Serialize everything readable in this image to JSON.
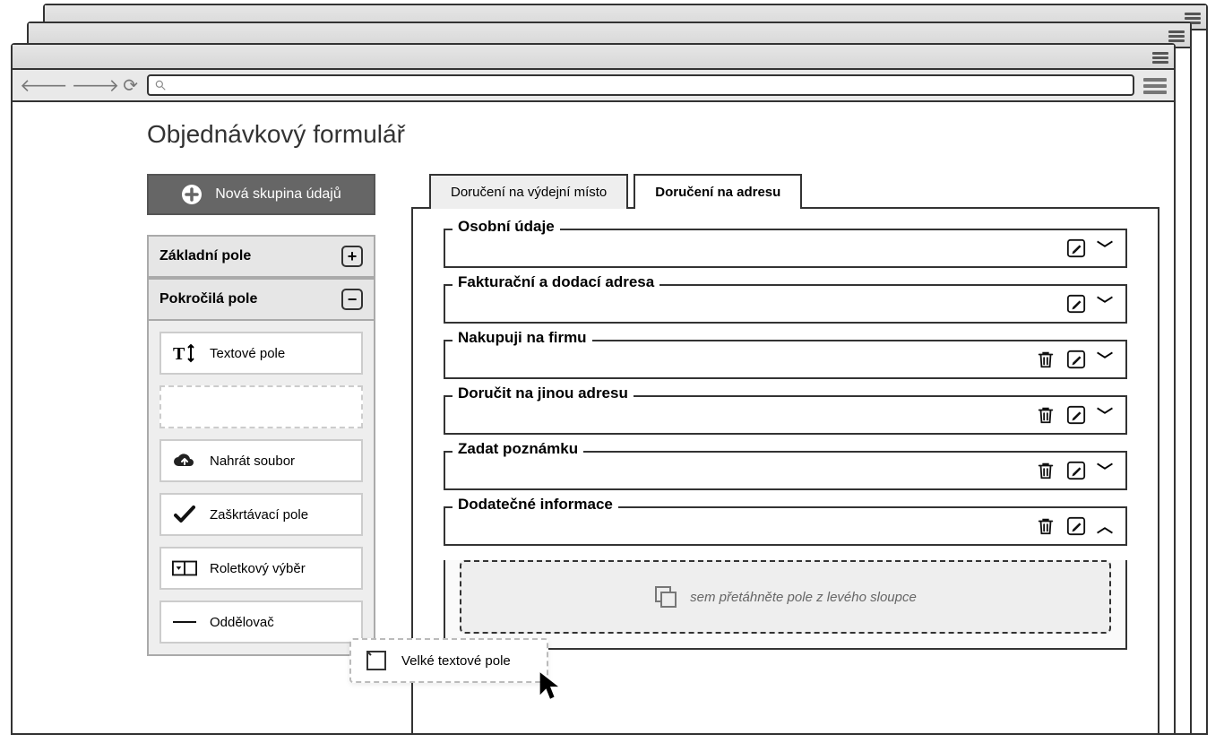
{
  "page_title": "Objednávkový formulář",
  "new_group_button": "Nová skupina údajů",
  "sidebar": {
    "basic_header": "Základní pole",
    "advanced_header": "Pokročilá pole",
    "items": [
      {
        "label": "Textové pole"
      },
      {
        "label": ""
      },
      {
        "label": "Nahrát soubor"
      },
      {
        "label": "Zaškrtávací pole"
      },
      {
        "label": "Roletkový výběr"
      },
      {
        "label": "Oddělovač"
      }
    ]
  },
  "tabs": {
    "inactive": "Doručení na výdejní místo",
    "active": "Doručení na adresu"
  },
  "form_groups": [
    {
      "legend": "Osobní údaje",
      "deletable": false,
      "expanded": false
    },
    {
      "legend": "Fakturační a dodací adresa",
      "deletable": false,
      "expanded": false
    },
    {
      "legend": "Nakupuji na firmu",
      "deletable": true,
      "expanded": false
    },
    {
      "legend": "Doručit na jinou adresu",
      "deletable": true,
      "expanded": false
    },
    {
      "legend": "Zadat poznámku",
      "deletable": true,
      "expanded": false
    },
    {
      "legend": "Dodatečné informace",
      "deletable": true,
      "expanded": true
    }
  ],
  "dropzone_hint": "sem přetáhněte pole z levého sloupce",
  "dragging_label": "Velké textové pole"
}
